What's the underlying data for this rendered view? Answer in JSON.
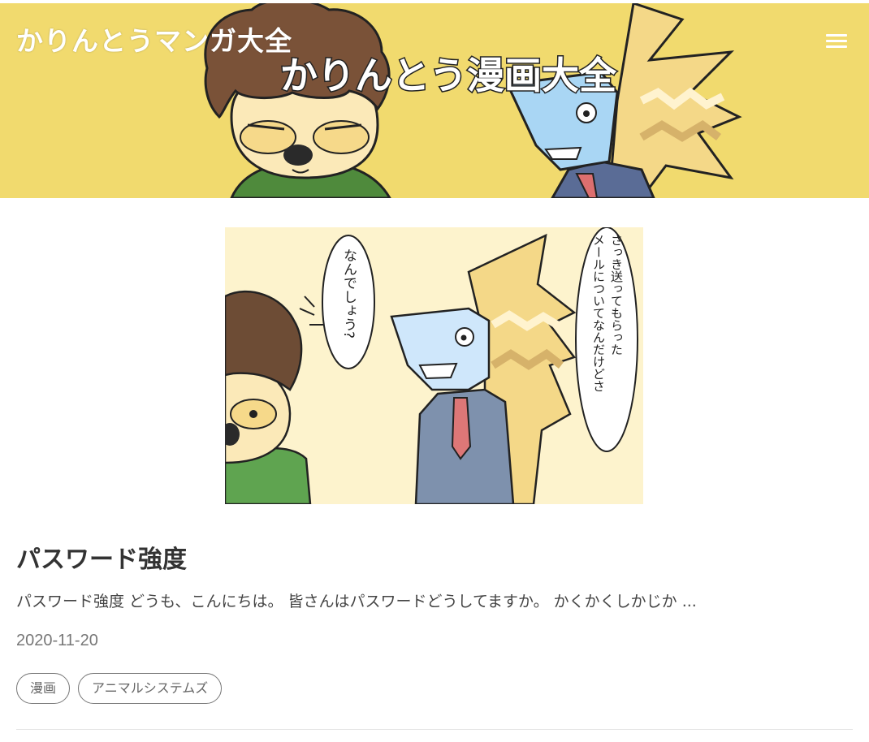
{
  "header": {
    "site_title": "かりんとうマンガ大全",
    "banner_text": "かりんとう漫画大全",
    "menu_icon": "hamburger-menu-icon",
    "background_color": "#f1da6e"
  },
  "article": {
    "title": "パスワード強度",
    "excerpt": "パスワード強度 どうも、こんにちは。 皆さんはパスワードどうしてますか。 かくかくしかじか ...",
    "date": "2020-11-20",
    "thumbnail": {
      "speech_left": "なんでしょう?",
      "speech_right_line1": "さっき送ってもらった",
      "speech_right_line2": "メールについてなんだけどさ"
    },
    "tags": [
      {
        "label": "漫画"
      },
      {
        "label": "アニマルシステムズ"
      }
    ]
  }
}
